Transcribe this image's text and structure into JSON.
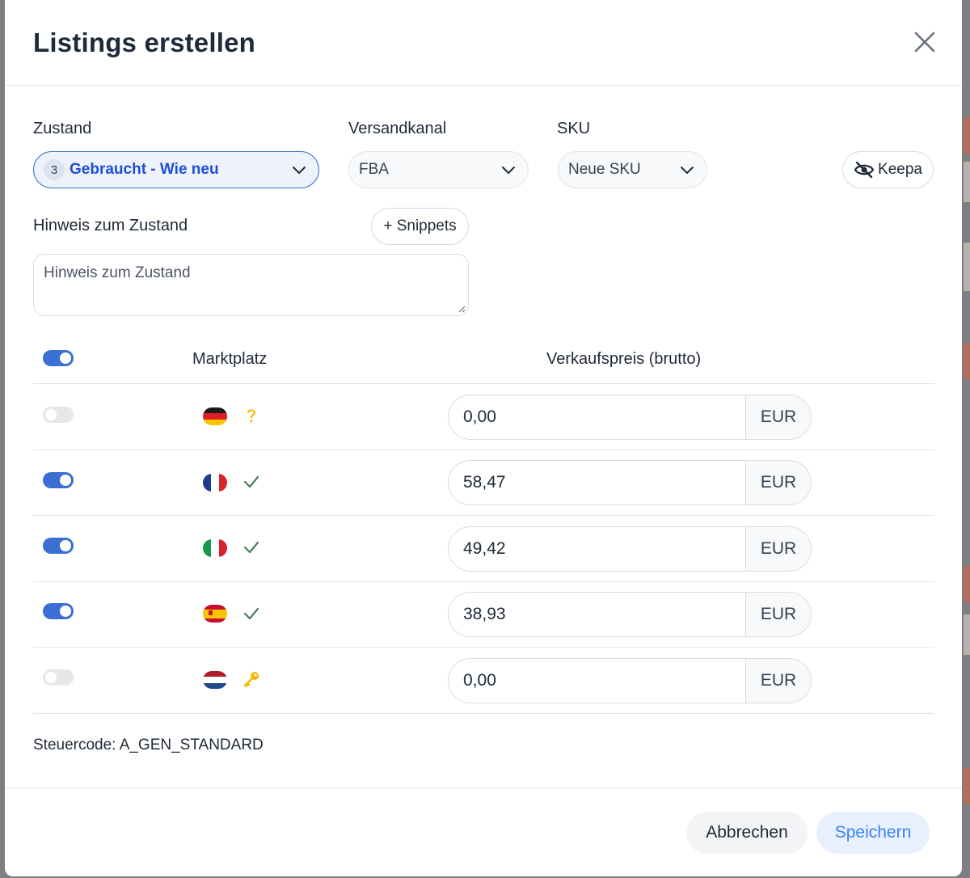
{
  "dialog": {
    "title": "Listings erstellen"
  },
  "form": {
    "zustand": {
      "label": "Zustand",
      "badge": "3",
      "value": "Gebraucht - Wie neu"
    },
    "versandkanal": {
      "label": "Versandkanal",
      "value": "FBA"
    },
    "sku": {
      "label": "SKU",
      "value": "Neue SKU"
    },
    "keepa_label": "Keepa",
    "hinweis_label": "Hinweis zum Zustand",
    "snippets_label": "+ Snippets",
    "hinweis_placeholder": "Hinweis zum Zustand"
  },
  "table": {
    "col_marketplace": "Marktplatz",
    "col_price": "Verkaufspreis (brutto)",
    "all_enabled": true,
    "rows": [
      {
        "country": "DE",
        "enabled": false,
        "status": "question",
        "price": "0,00",
        "currency": "EUR"
      },
      {
        "country": "FR",
        "enabled": true,
        "status": "check",
        "price": "58,47",
        "currency": "EUR"
      },
      {
        "country": "IT",
        "enabled": true,
        "status": "check",
        "price": "49,42",
        "currency": "EUR"
      },
      {
        "country": "ES",
        "enabled": true,
        "status": "check",
        "price": "38,93",
        "currency": "EUR"
      },
      {
        "country": "NL",
        "enabled": false,
        "status": "key",
        "price": "0,00",
        "currency": "EUR"
      }
    ]
  },
  "tax": {
    "text": "Steuercode: A_GEN_STANDARD"
  },
  "footer": {
    "cancel_label": "Abbrechen",
    "save_label": "Speichern"
  },
  "colors": {
    "accent": "#3b6fd4",
    "check": "#4b7a5a",
    "warning": "#f5b800"
  }
}
